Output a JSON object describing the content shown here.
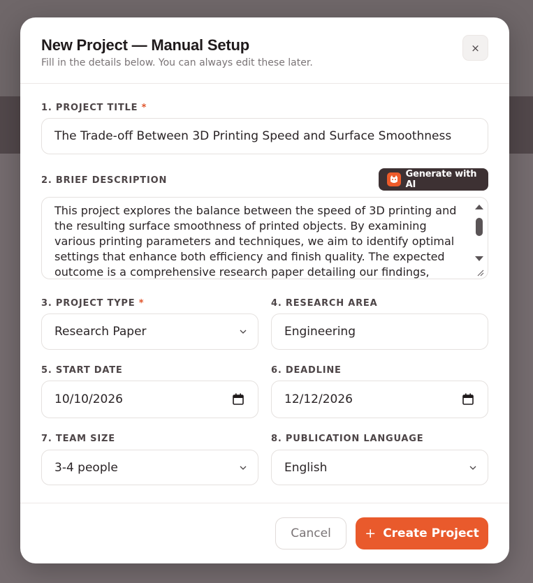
{
  "modal": {
    "title": "New Project — Manual Setup",
    "subtitle": "Fill in the details below. You can always edit these later.",
    "close_label": "×"
  },
  "fields": {
    "title": {
      "label": "1. PROJECT TITLE",
      "required": "*",
      "value": "The Trade-off Between 3D Printing Speed and Surface Smoothness"
    },
    "description": {
      "label": "2. BRIEF DESCRIPTION",
      "value": "This project explores the balance between the speed of 3D printing and the resulting surface smoothness of printed objects. By examining various printing parameters and techniques, we aim to identify optimal settings that enhance both efficiency and finish quality. The expected outcome is a comprehensive research paper detailing our findings,",
      "ai_button_label": "Generate with AI"
    },
    "type": {
      "label": "3. PROJECT TYPE",
      "required": "*",
      "value": "Research Paper"
    },
    "area": {
      "label": "4. RESEARCH AREA",
      "value": "Engineering"
    },
    "start_date": {
      "label": "5. START DATE",
      "value": "10/10/2026"
    },
    "deadline": {
      "label": "6. DEADLINE",
      "value": "12/12/2026"
    },
    "team_size": {
      "label": "7. TEAM SIZE",
      "value": "3-4 people"
    },
    "language": {
      "label": "8. PUBLICATION LANGUAGE",
      "value": "English"
    }
  },
  "footer": {
    "cancel_label": "Cancel",
    "create_label": "Create Project",
    "create_icon": "+"
  },
  "colors": {
    "accent": "#e95a2c",
    "dark_button": "#3d3133",
    "required": "#e0542a"
  },
  "icons": {
    "close": "close-icon",
    "chevron": "chevron-down-icon",
    "calendar": "calendar-icon",
    "ai": "ai-logo-icon",
    "plus": "plus-icon"
  }
}
